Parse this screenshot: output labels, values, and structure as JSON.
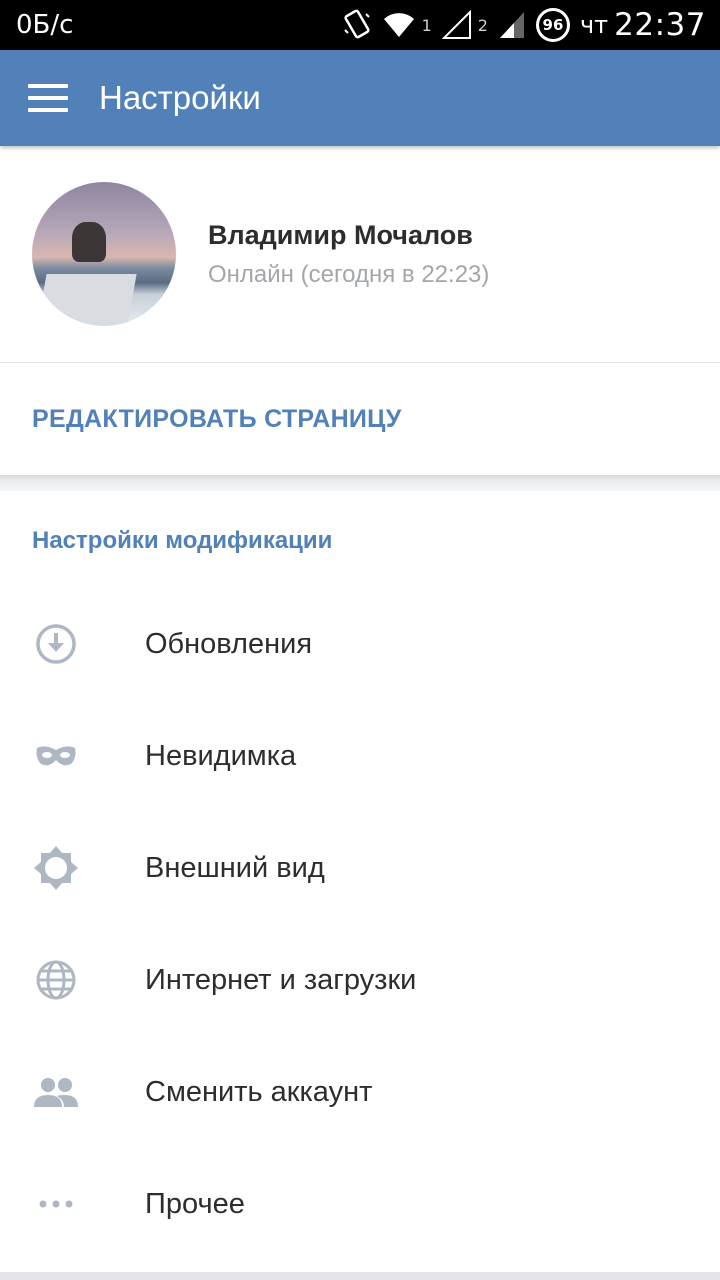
{
  "statusbar": {
    "speed": "0Б/с",
    "sim1": "1",
    "sim2": "2",
    "battery": "96",
    "day": "чт",
    "time": "22:37"
  },
  "toolbar": {
    "title": "Настройки",
    "menu_icon": "hamburger-menu-icon"
  },
  "profile": {
    "name": "Владимир Мочалов",
    "status": "Онлайн (сегодня в 22:23)"
  },
  "edit_page": {
    "label": "РЕДАКТИРОВАТЬ СТРАНИЦУ"
  },
  "section": {
    "title": "Настройки модификации"
  },
  "menu": {
    "items": [
      {
        "label": "Обновления",
        "icon": "download-circle-icon"
      },
      {
        "label": "Невидимка",
        "icon": "mask-icon"
      },
      {
        "label": "Внешний вид",
        "icon": "brightness-icon"
      },
      {
        "label": "Интернет и загрузки",
        "icon": "globe-icon"
      },
      {
        "label": "Сменить аккаунт",
        "icon": "people-icon"
      },
      {
        "label": "Прочее",
        "icon": "more-dots-icon"
      }
    ]
  },
  "colors": {
    "accent": "#5181b8",
    "icon_gray": "#aeb7c2",
    "text": "#2c2d2e",
    "secondary_text": "#a3a6aa"
  }
}
